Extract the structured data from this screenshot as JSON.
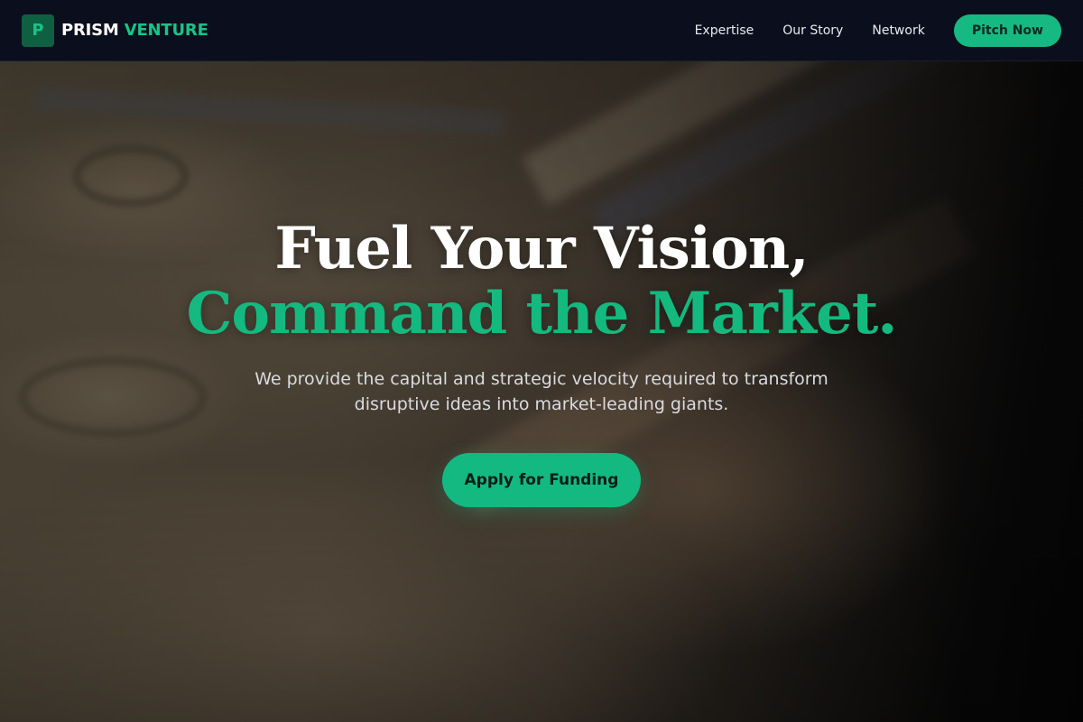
{
  "brand": {
    "logo_letter": "P",
    "name_part1": "PRISM",
    "name_part2": "VENTURE"
  },
  "nav": {
    "links": [
      "Expertise",
      "Our Story",
      "Network"
    ],
    "cta_label": "Pitch Now"
  },
  "hero": {
    "headline_line1": "Fuel Your Vision,",
    "headline_line2": "Command the Market.",
    "subtext": "We provide the capital and strategic velocity required to transform disruptive ideas into market-leading giants.",
    "cta_label": "Apply for Funding"
  },
  "colors": {
    "accent": "#14b981",
    "navbar_bg": "#0b0f1d",
    "logo_bg": "#0f5f43",
    "text_primary": "#ffffff",
    "text_secondary": "#d9dbe0"
  }
}
